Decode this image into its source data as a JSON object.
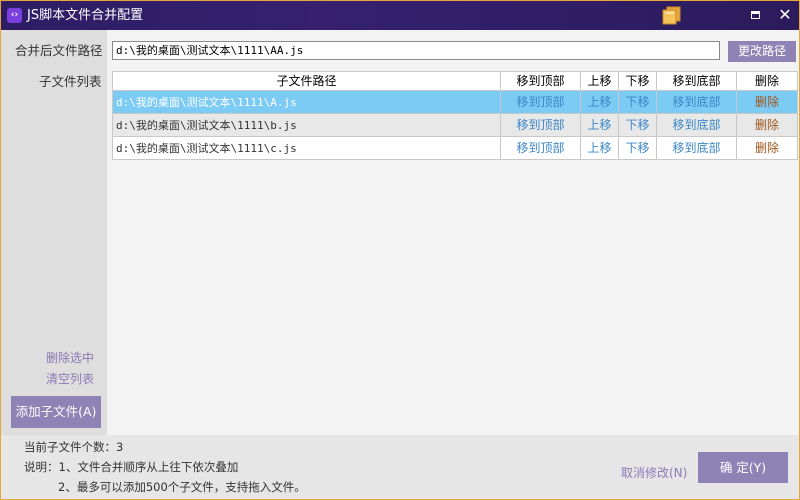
{
  "window": {
    "title": "JS脚本文件合并配置",
    "app_icon_text": "‹›",
    "accent_color": "#8f82b5",
    "titlebar_color": "#2d1d63"
  },
  "sidebar": {
    "merged_path_label": "合并后文件路径",
    "children_label": "子文件列表",
    "delete_selected": "删除选中",
    "clear_list": "清空列表",
    "add_button": "添加子文件(A)"
  },
  "path": {
    "value": "d:\\我的桌面\\测试文本\\1111\\AA.js",
    "change_button": "更改路径"
  },
  "table": {
    "columns": [
      "子文件路径",
      "移到顶部",
      "上移",
      "下移",
      "移到底部",
      "删除"
    ],
    "rows": [
      {
        "path": "d:\\我的桌面\\测试文本\\1111\\A.js",
        "top": "移到顶部",
        "up": "上移",
        "down": "下移",
        "bottom": "移到底部",
        "del": "删除"
      },
      {
        "path": "d:\\我的桌面\\测试文本\\1111\\b.js",
        "top": "移到顶部",
        "up": "上移",
        "down": "下移",
        "bottom": "移到底部",
        "del": "删除"
      },
      {
        "path": "d:\\我的桌面\\测试文本\\1111\\c.js",
        "top": "移到顶部",
        "up": "上移",
        "down": "下移",
        "bottom": "移到底部",
        "del": "删除"
      }
    ],
    "selected_row": 0
  },
  "footer": {
    "count_text": "当前子文件个数：3",
    "note_line1": "说明：1、文件合并顺序从上往下依次叠加",
    "note_line2": "2、最多可以添加500个子文件，支持拖入文件。",
    "cancel_link": "取消修改(N)",
    "ok_button": "确 定(Y)"
  }
}
